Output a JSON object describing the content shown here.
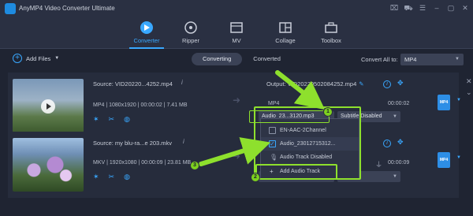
{
  "app": {
    "title": "AnyMP4 Video Converter Ultimate"
  },
  "nav": {
    "tabs": [
      {
        "label": "Converter"
      },
      {
        "label": "Ripper"
      },
      {
        "label": "MV"
      },
      {
        "label": "Collage"
      },
      {
        "label": "Toolbox"
      }
    ]
  },
  "toolbar": {
    "add_files": "Add Files",
    "converting": "Converting",
    "converted": "Converted",
    "convert_all_label": "Convert All to:",
    "convert_all_value": "MP4"
  },
  "rows": [
    {
      "source": "Source: VID20220...4252.mp4",
      "meta_fmt": "MP4",
      "meta_res": "1080x1920",
      "meta_dur": "00:00:02",
      "meta_size": "7.41 MB",
      "output": "Output: VID20220502084252.mp4",
      "out_fmt": "MP4",
      "out_dur": "00:00:02",
      "format_badge": "MP4",
      "audio_select": "Audio_23...3120.mp3",
      "subtitle_select": "Subtitle Disabled"
    },
    {
      "source": "Source: my blu-ra...e 203.mkv",
      "meta_fmt": "MKV",
      "meta_res": "1920x1080",
      "meta_dur": "00:00:09",
      "meta_size": "23.81 MB",
      "out_dur": "00:00:09",
      "format_badge": "MP4"
    }
  ],
  "dropdown": {
    "items": [
      {
        "label": "EN-AAC-2Channel"
      },
      {
        "label": "Audio_230127153​12..."
      },
      {
        "label": "Audio Track Disabled"
      },
      {
        "label": "Add Audio Track"
      }
    ]
  },
  "callouts": [
    {
      "label": "1"
    },
    {
      "label": "2"
    },
    {
      "label": "3"
    }
  ],
  "colors": {
    "accent": "#39a8ff",
    "highlight": "#8ee02d",
    "background": "#1f2432"
  }
}
